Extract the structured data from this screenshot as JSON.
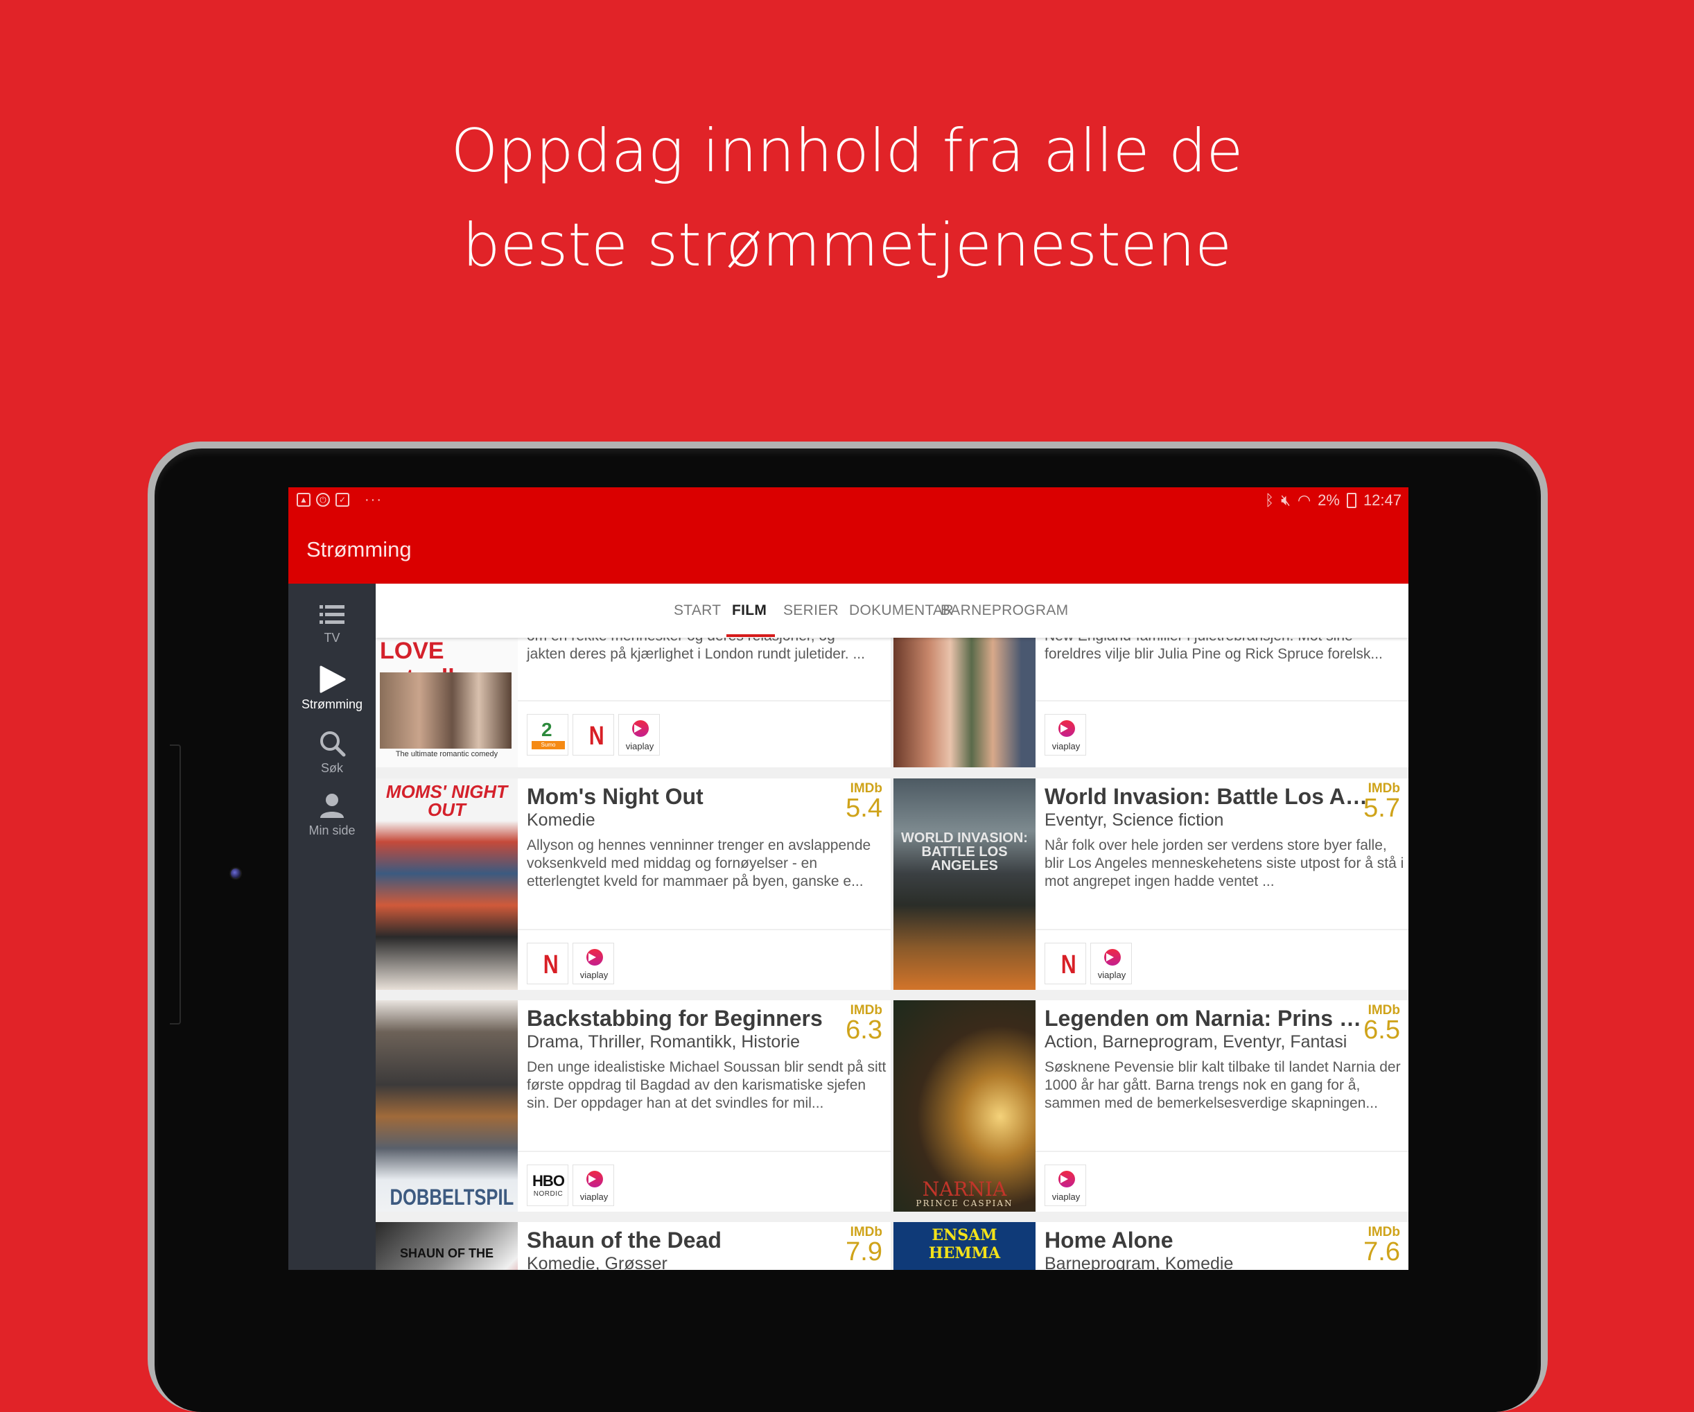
{
  "headline": {
    "line1": "Oppdag innhold fra alle de",
    "line2": "beste strømmetjenestene"
  },
  "statusbar": {
    "left_icons": [
      "gallery-icon",
      "sync-icon",
      "mail-icon"
    ],
    "more": "···",
    "right_icons": [
      "bluetooth-icon",
      "mute-icon",
      "wifi-icon"
    ],
    "battery": "2%",
    "time": "12:47"
  },
  "appbar": {
    "title": "Strømming"
  },
  "sidebar": {
    "items": [
      {
        "label": "TV",
        "icon": "list-icon",
        "active": false
      },
      {
        "label": "Strømming",
        "icon": "play-icon",
        "active": true
      },
      {
        "label": "Søk",
        "icon": "search-icon",
        "active": false
      },
      {
        "label": "Min side",
        "icon": "person-icon",
        "active": false
      }
    ]
  },
  "tabs": [
    {
      "label": "START",
      "active": false
    },
    {
      "label": "FILM",
      "active": true
    },
    {
      "label": "SERIER",
      "active": false
    },
    {
      "label": "DOKUMENTAR",
      "active": false
    },
    {
      "label": "BARNEPROGRAM",
      "active": false
    }
  ],
  "colors": {
    "brand_red": "#da0000",
    "background_red": "#e12328",
    "sidebar": "#2f333b",
    "imdb_gold": "#cfa31a",
    "netflix": "#d81f26"
  },
  "imdb_label": "IMDb",
  "cards": [
    {
      "title": "",
      "genre": "",
      "desc_partial_top": "om en rekke mennesker og deres relasjoner, og",
      "desc": "jakten deres på kjærlighet i London rundt juletider. ...",
      "poster": {
        "title": "LOVE actually",
        "tagline": "The ultimate romantic comedy"
      },
      "providers": [
        "tv2-sumo",
        "netflix",
        "viaplay"
      ]
    },
    {
      "title": "",
      "genre": "",
      "desc_partial_top": "New England-familier i juletrebransjen. Mot sine",
      "desc": "foreldres vilje blir Julia Pine og Rick Spruce forelsk...",
      "poster": {
        "title": ""
      },
      "providers": [
        "viaplay"
      ]
    },
    {
      "title": "Mom's Night Out",
      "genre": "Komedie",
      "imdb": "5.4",
      "desc": "Allyson og hennes venninner trenger en avslappende voksenkveld med middag og fornøyelser - en etterlengtet kveld for mammaer på byen, ganske e...",
      "poster": {
        "title": "MOMS' NIGHT OUT"
      },
      "providers": [
        "netflix",
        "viaplay"
      ]
    },
    {
      "title": "World Invasion: Battle Los An...",
      "genre": "Eventyr, Science fiction",
      "imdb": "5.7",
      "desc": "Når folk over hele jorden ser verdens store byer falle, blir Los Angeles menneskehetens siste utpost for å stå i mot angrepet ingen hadde ventet ...",
      "poster": {
        "title": "WORLD INVASION: BATTLE LOS ANGELES"
      },
      "providers": [
        "netflix",
        "viaplay"
      ]
    },
    {
      "title": "Backstabbing for Beginners",
      "genre": "Drama, Thriller, Romantikk, Historie",
      "imdb": "6.3",
      "desc": "Den unge idealistiske Michael Soussan blir sendt på sitt første oppdrag til Bagdad av den karismatiske sjefen sin. Der oppdager han at det svindles for mil...",
      "poster": {
        "title": "DOBBELTSPIL"
      },
      "providers": [
        "hbo-nordic",
        "viaplay"
      ]
    },
    {
      "title": "Legenden om Narnia: Prins C...",
      "genre": "Action, Barneprogram, Eventyr, Fantasi",
      "imdb": "6.5",
      "desc": "Søsknene Pevensie blir kalt tilbake til landet Narnia der 1000 år har gått. Barna trengs nok en gang for å, sammen med de bemerkelsesverdige skapningen...",
      "poster": {
        "title": "NARNIA",
        "subtitle": "PRINCE CASPIAN"
      },
      "providers": [
        "viaplay"
      ]
    },
    {
      "title": "Shaun of the Dead",
      "genre": "Komedie, Grøsser",
      "imdb": "7.9",
      "desc": "",
      "poster": {
        "title": "SHAUN OF THE"
      },
      "providers": []
    },
    {
      "title": "Home Alone",
      "genre": "Barneprogram, Komedie",
      "imdb": "7.6",
      "desc": "",
      "poster": {
        "title": "ENSAM HEMMA"
      },
      "providers": []
    }
  ],
  "provider_labels": {
    "viaplay": "viaplay",
    "netflix": "N",
    "tv2": "2",
    "sumo": "Sumo",
    "hbo": "HBO",
    "nordic": "NORDIC"
  }
}
